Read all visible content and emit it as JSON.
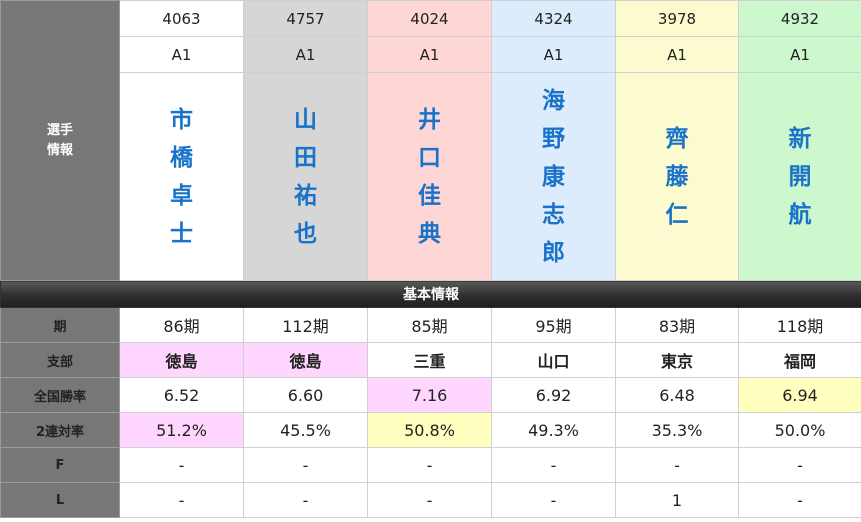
{
  "side_labels": {
    "player_info": "選手\n情報",
    "period": "期",
    "branch": "支部",
    "national_win_rate": "全国勝率",
    "two_rate": "2連対率",
    "f": "F",
    "l": "L"
  },
  "section_title": "基本情報",
  "players": [
    {
      "number": "4063",
      "class": "A1",
      "name": "市\n橋\n卓\n士",
      "period": "86期",
      "branch": "徳島",
      "win_rate": "6.52",
      "two_rate": "51.2%",
      "f": "-",
      "l": "-",
      "bg": "#ffffff"
    },
    {
      "number": "4757",
      "class": "A1",
      "name": "山\n田\n祐\n也",
      "period": "112期",
      "branch": "徳島",
      "win_rate": "6.60",
      "two_rate": "45.5%",
      "f": "-",
      "l": "-",
      "bg": "#d6d6d6"
    },
    {
      "number": "4024",
      "class": "A1",
      "name": "井\n口\n佳\n典",
      "period": "85期",
      "branch": "三重",
      "win_rate": "7.16",
      "two_rate": "50.8%",
      "f": "-",
      "l": "-",
      "bg": "#ffd6d6"
    },
    {
      "number": "4324",
      "class": "A1",
      "name": "海\n野\n康\n志\n郎",
      "period": "95期",
      "branch": "山口",
      "win_rate": "6.92",
      "two_rate": "49.3%",
      "f": "-",
      "l": "-",
      "bg": "#dcecfc"
    },
    {
      "number": "3978",
      "class": "A1",
      "name": "齊\n藤\n仁",
      "period": "83期",
      "branch": "東京",
      "win_rate": "6.48",
      "two_rate": "35.3%",
      "f": "-",
      "l": "1",
      "bg": "#fbfbcf"
    },
    {
      "number": "4932",
      "class": "A1",
      "name": "新\n開\n航",
      "period": "118期",
      "branch": "福岡",
      "win_rate": "6.94",
      "two_rate": "50.0%",
      "f": "-",
      "l": "-",
      "bg": "#cdf7cd"
    }
  ],
  "highlights": {
    "branch": [
      "#ffd6ff",
      "#ffd6ff",
      "",
      "",
      "",
      ""
    ],
    "win_rate": [
      "",
      "",
      "#ffd6ff",
      "",
      "",
      "#ffffc0"
    ],
    "two_rate": [
      "#ffd6ff",
      "",
      "#ffffc0",
      "",
      "",
      ""
    ]
  }
}
